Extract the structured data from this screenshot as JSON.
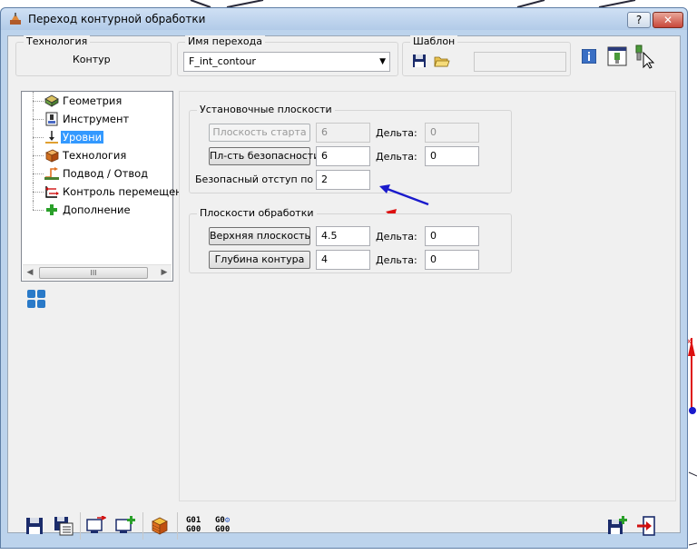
{
  "window": {
    "title": "Переход контурной обработки",
    "help_label": "?",
    "close_label": "✕"
  },
  "top": {
    "technology_label": "Технология",
    "technology_value": "Контур",
    "transition_name_label": "Имя перехода",
    "transition_name_value": "F_int_contour",
    "template_label": "Шаблон",
    "template_value": ""
  },
  "tree": {
    "items": [
      {
        "label": "Геометрия",
        "icon": "geometry-icon"
      },
      {
        "label": "Инструмент",
        "icon": "tool-icon"
      },
      {
        "label": "Уровни",
        "icon": "levels-icon",
        "selected": true
      },
      {
        "label": "Технология",
        "icon": "technology-icon"
      },
      {
        "label": "Подвод / Отвод",
        "icon": "approach-icon"
      },
      {
        "label": "Контроль перемещений",
        "icon": "move-control-icon"
      },
      {
        "label": "Дополнение",
        "icon": "addition-icon"
      }
    ],
    "scroll_thumb_label": "III"
  },
  "setup_planes": {
    "title": "Установочные плоскости",
    "start_plane_label": "Плоскость старта",
    "start_plane_value": "6",
    "delta_label": "Дельта:",
    "start_delta_value": "0",
    "safety_plane_label": "Пл-сть безопасности",
    "safety_plane_value": "6",
    "safety_delta_value": "0",
    "safe_offset_label": "Безопасный отступ по Z:",
    "safe_offset_value": "2"
  },
  "machining_planes": {
    "title": "Плоскости обработки",
    "top_plane_label": "Верхняя плоскость",
    "top_plane_value": "4.5",
    "delta_label": "Дельта:",
    "top_delta_value": "0",
    "depth_label": "Глубина контура",
    "depth_value": "4",
    "depth_delta_value": "0"
  },
  "gcode": {
    "first": [
      "G01",
      "G00"
    ],
    "second": [
      "G0",
      "G00"
    ]
  },
  "colors": {
    "blue_arrow": "#1a1acc",
    "red_arrow": "#dd1111",
    "selection": "#3399ff"
  }
}
